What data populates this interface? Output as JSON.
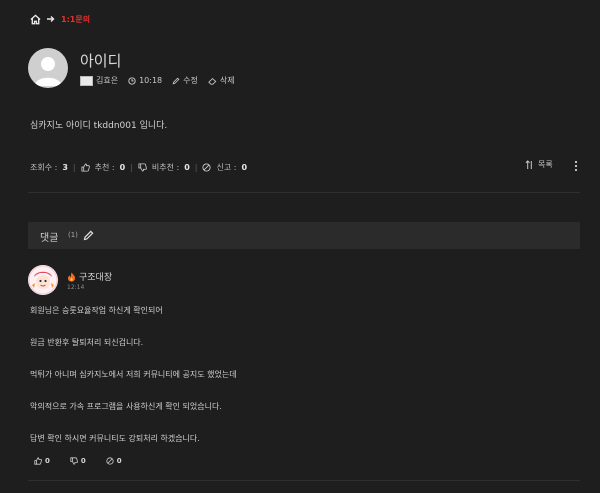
{
  "breadcrumb": {
    "board": "1:1문의"
  },
  "post": {
    "title": "아이디",
    "author": "김효은",
    "time": "10:18",
    "edit_label": "수정",
    "delete_label": "삭제",
    "content": "심카지노 아이디 tkddn001 입니다."
  },
  "stats": {
    "views_label": "조회수 :",
    "views": "3",
    "like_label": "추천 :",
    "likes": "0",
    "dislike_label": "비추천 :",
    "dislikes": "0",
    "report_label": "신고 :",
    "reports": "0"
  },
  "actions": {
    "list_label": "목록"
  },
  "comments": {
    "header_label": "댓글",
    "count": "(1)",
    "items": [
      {
        "author": "구조대장",
        "time": "12:14",
        "lines": [
          "회원님은 승룻요율작업 하신게 확인되어",
          "원금 반환후 탈퇴처리 되신겁니다.",
          "먹튀가 아니며 심카지노에서 저희 커뮤니티에 공지도 했었는데",
          "악의적으로 가속 프로그램을 사용하신게 확인 되었습니다.",
          "답변 확인 하시면 커뮤니티도 강퇴처리 하겠습니다."
        ],
        "likes": "0",
        "dislikes": "0",
        "reports": "0"
      }
    ]
  },
  "colors": {
    "background": "#1e1e1e",
    "accent": "#e0332e",
    "panel": "#2b2b2b"
  },
  "icons": [
    "home-icon",
    "arrow-right-icon",
    "clock-icon",
    "pencil-icon",
    "eraser-icon",
    "thumbs-up-icon",
    "thumbs-down-icon",
    "ban-icon",
    "sort-icon",
    "more-vertical-icon",
    "fire-icon"
  ]
}
